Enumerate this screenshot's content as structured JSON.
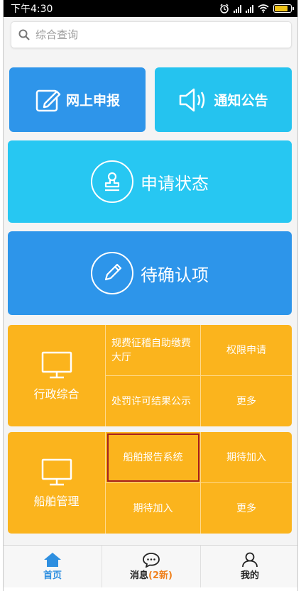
{
  "status_bar": {
    "time": "下午4:30"
  },
  "search": {
    "placeholder": "综合查询"
  },
  "tiles": {
    "online_report": "网上申报",
    "notice": "通知公告",
    "apply_status": "申请状态",
    "pending_confirm": "待确认项"
  },
  "admin_panel": {
    "title": "行政综合",
    "cells": [
      "规费征稽自助缴费大厅",
      "权限申请",
      "处罚许可结果公示",
      "更多"
    ]
  },
  "ship_panel": {
    "title": "船舶管理",
    "cells": [
      "船舶报告系统",
      "期待加入",
      "期待加入",
      "更多"
    ]
  },
  "bottom_nav": {
    "home": "首页",
    "messages": "消息",
    "messages_badge": "(2新)",
    "mine": "我的"
  },
  "colors": {
    "blue": "#2e95ea",
    "cyan": "#25c3ef",
    "orange": "#fbb41d",
    "highlight": "#a52020"
  }
}
